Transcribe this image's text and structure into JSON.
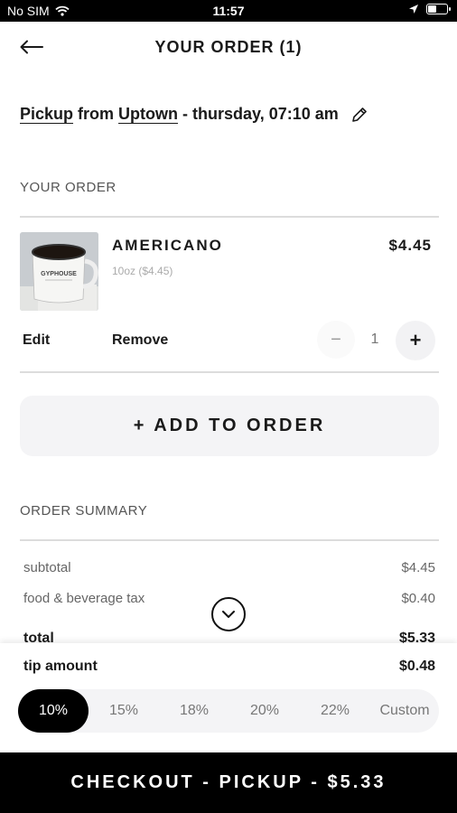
{
  "status_bar": {
    "carrier": "No SIM",
    "time": "11:57"
  },
  "header": {
    "title": "YOUR ORDER (1)"
  },
  "pickup": {
    "mode": "Pickup",
    "from_word": "from",
    "location": "Uptown",
    "datetime": "- thursday, 07:10 am"
  },
  "order_section": {
    "label": "YOUR ORDER"
  },
  "item": {
    "name": "AMERICANO",
    "size": "10oz ($4.45)",
    "price": "$4.45",
    "edit_label": "Edit",
    "remove_label": "Remove",
    "quantity": "1",
    "mug_text": "GYPHOUSE"
  },
  "add_to_order": {
    "label": "+ ADD TO ORDER"
  },
  "summary": {
    "label": "ORDER SUMMARY",
    "rows": [
      {
        "label": "subtotal",
        "value": "$4.45"
      },
      {
        "label": "food & beverage tax",
        "value": "$0.40"
      },
      {
        "label": "total",
        "value": "$5.33"
      }
    ]
  },
  "tip": {
    "label": "tip amount",
    "amount": "$0.48",
    "options": [
      "10%",
      "15%",
      "18%",
      "20%",
      "22%",
      "Custom"
    ],
    "selected": "10%"
  },
  "checkout": {
    "label": "CHECKOUT - PICKUP - $5.33"
  },
  "colors": {
    "primary": "#000000",
    "surface": "#f4f4f6",
    "divider": "#dcdcdc"
  },
  "icons": {
    "back": "arrow-left-icon",
    "edit": "pencil-icon",
    "collapse": "chevron-down-circle-icon",
    "wifi": "wifi-icon",
    "location": "location-arrow-icon",
    "battery": "battery-icon"
  }
}
